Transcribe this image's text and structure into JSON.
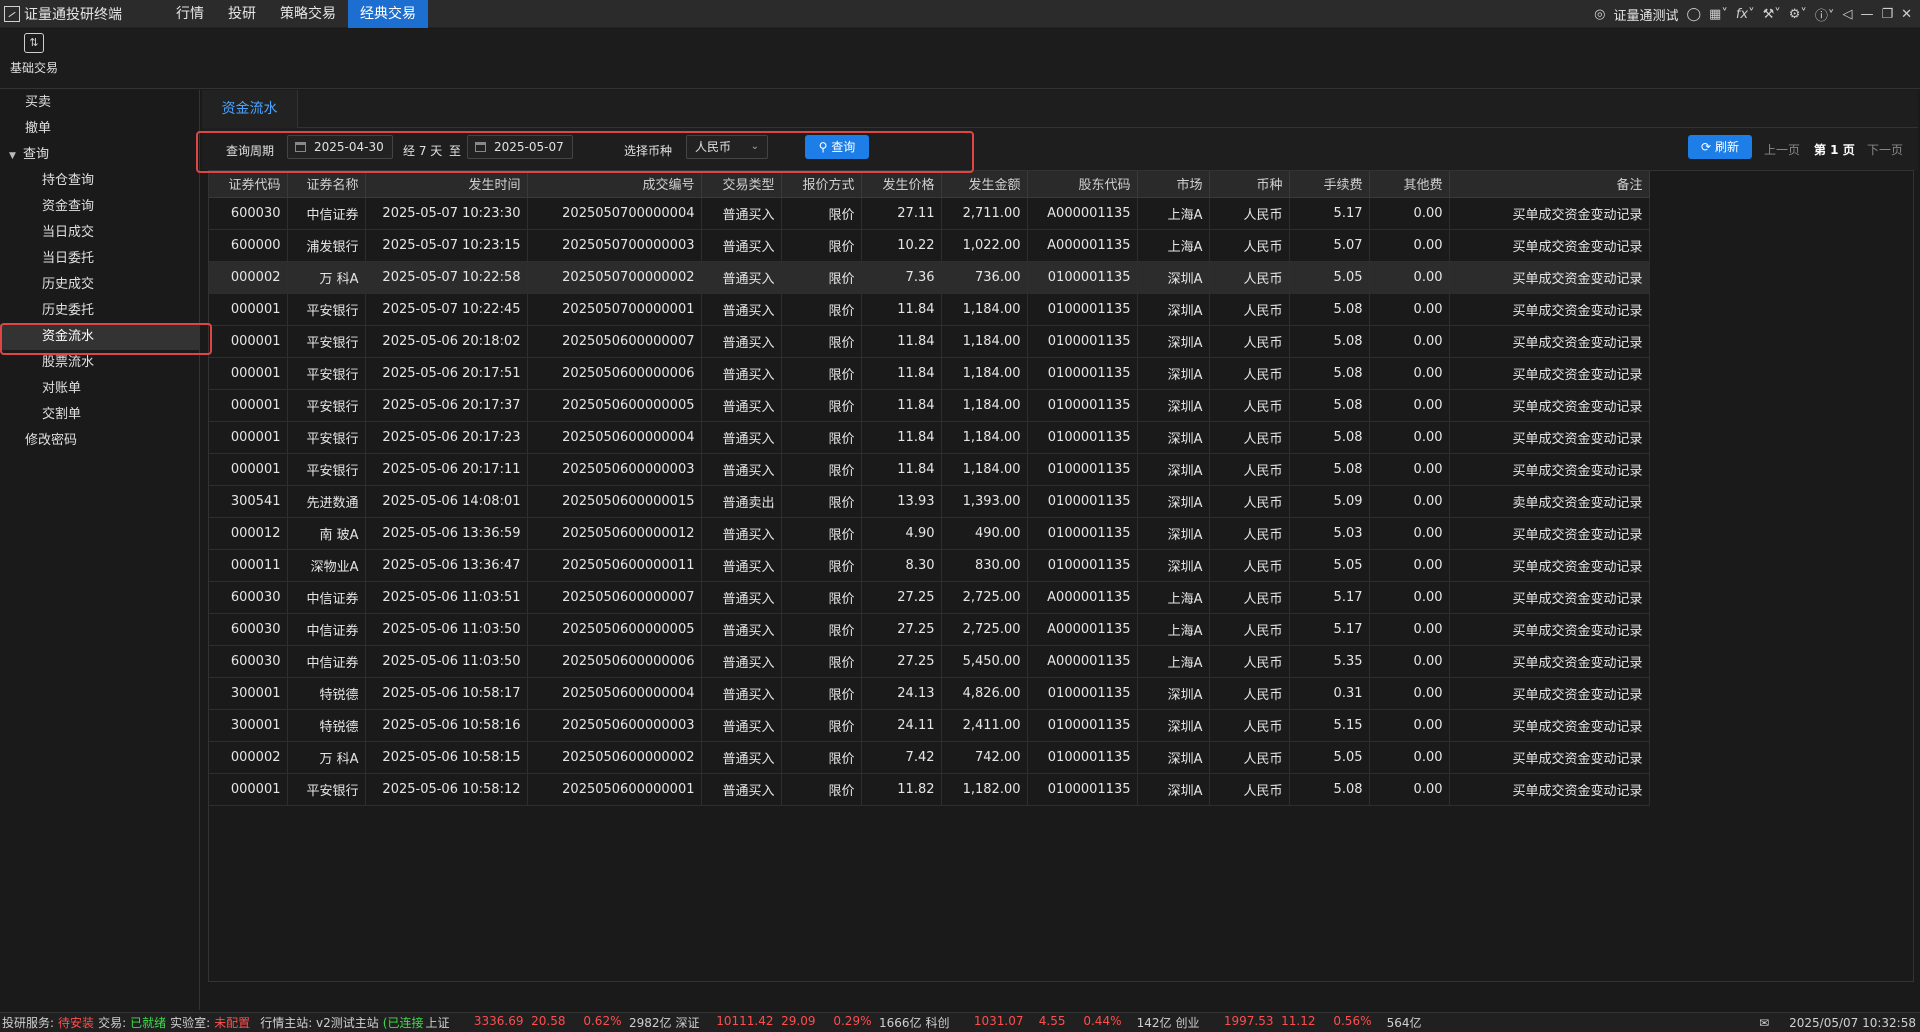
{
  "app": {
    "title": "证量通投研终端",
    "menus": [
      "行情",
      "投研",
      "策略交易",
      "经典交易"
    ],
    "active_menu_index": 3,
    "user": "证量通测试",
    "accent_color": "#1e7ee8"
  },
  "toolbar": {
    "basic_trade_label": "基础交易"
  },
  "sidebar": {
    "items": [
      {
        "label": "买卖",
        "level": 1
      },
      {
        "label": "撤单",
        "level": 1
      },
      {
        "label": "查询",
        "level": 1,
        "expanded": true
      },
      {
        "label": "持仓查询",
        "level": 2
      },
      {
        "label": "资金查询",
        "level": 2
      },
      {
        "label": "当日成交",
        "level": 2
      },
      {
        "label": "当日委托",
        "level": 2
      },
      {
        "label": "历史成交",
        "level": 2
      },
      {
        "label": "历史委托",
        "level": 2
      },
      {
        "label": "资金流水",
        "level": 2,
        "selected": true
      },
      {
        "label": "股票流水",
        "level": 2
      },
      {
        "label": "对账单",
        "level": 2
      },
      {
        "label": "交割单",
        "level": 2
      },
      {
        "label": "修改密码",
        "level": 1
      }
    ]
  },
  "tab": {
    "label": "资金流水"
  },
  "query": {
    "period_label": "查询周期",
    "start_date": "2025-04-30",
    "span_label": "经 7 天",
    "to_label": "至",
    "end_date": "2025-05-07",
    "currency_label": "选择币种",
    "currency_value": "人民币",
    "query_button": "查询",
    "refresh_button": "刷新",
    "prev_page": "上一页",
    "current_page": "第 1 页",
    "next_page": "下一页"
  },
  "table": {
    "columns": [
      "证券代码",
      "证券名称",
      "发生时间",
      "成交编号",
      "交易类型",
      "报价方式",
      "发生价格",
      "发生金额",
      "股东代码",
      "市场",
      "币种",
      "手续费",
      "其他费",
      "备注"
    ],
    "highlighted_row": 2,
    "rows": [
      [
        "600030",
        "中信证券",
        "2025-05-07 10:23:30",
        "2025050700000004",
        "普通买入",
        "限价",
        "27.11",
        "2,711.00",
        "A000001135",
        "上海A",
        "人民币",
        "5.17",
        "0.00",
        "买单成交资金变动记录"
      ],
      [
        "600000",
        "浦发银行",
        "2025-05-07 10:23:15",
        "2025050700000003",
        "普通买入",
        "限价",
        "10.22",
        "1,022.00",
        "A000001135",
        "上海A",
        "人民币",
        "5.07",
        "0.00",
        "买单成交资金变动记录"
      ],
      [
        "000002",
        "万 科A",
        "2025-05-07 10:22:58",
        "2025050700000002",
        "普通买入",
        "限价",
        "7.36",
        "736.00",
        "0100001135",
        "深圳A",
        "人民币",
        "5.05",
        "0.00",
        "买单成交资金变动记录"
      ],
      [
        "000001",
        "平安银行",
        "2025-05-07 10:22:45",
        "2025050700000001",
        "普通买入",
        "限价",
        "11.84",
        "1,184.00",
        "0100001135",
        "深圳A",
        "人民币",
        "5.08",
        "0.00",
        "买单成交资金变动记录"
      ],
      [
        "000001",
        "平安银行",
        "2025-05-06 20:18:02",
        "2025050600000007",
        "普通买入",
        "限价",
        "11.84",
        "1,184.00",
        "0100001135",
        "深圳A",
        "人民币",
        "5.08",
        "0.00",
        "买单成交资金变动记录"
      ],
      [
        "000001",
        "平安银行",
        "2025-05-06 20:17:51",
        "2025050600000006",
        "普通买入",
        "限价",
        "11.84",
        "1,184.00",
        "0100001135",
        "深圳A",
        "人民币",
        "5.08",
        "0.00",
        "买单成交资金变动记录"
      ],
      [
        "000001",
        "平安银行",
        "2025-05-06 20:17:37",
        "2025050600000005",
        "普通买入",
        "限价",
        "11.84",
        "1,184.00",
        "0100001135",
        "深圳A",
        "人民币",
        "5.08",
        "0.00",
        "买单成交资金变动记录"
      ],
      [
        "000001",
        "平安银行",
        "2025-05-06 20:17:23",
        "2025050600000004",
        "普通买入",
        "限价",
        "11.84",
        "1,184.00",
        "0100001135",
        "深圳A",
        "人民币",
        "5.08",
        "0.00",
        "买单成交资金变动记录"
      ],
      [
        "000001",
        "平安银行",
        "2025-05-06 20:17:11",
        "2025050600000003",
        "普通买入",
        "限价",
        "11.84",
        "1,184.00",
        "0100001135",
        "深圳A",
        "人民币",
        "5.08",
        "0.00",
        "买单成交资金变动记录"
      ],
      [
        "300541",
        "先进数通",
        "2025-05-06 14:08:01",
        "2025050600000015",
        "普通卖出",
        "限价",
        "13.93",
        "1,393.00",
        "0100001135",
        "深圳A",
        "人民币",
        "5.09",
        "0.00",
        "卖单成交资金变动记录"
      ],
      [
        "000012",
        "南 玻A",
        "2025-05-06 13:36:59",
        "2025050600000012",
        "普通买入",
        "限价",
        "4.90",
        "490.00",
        "0100001135",
        "深圳A",
        "人民币",
        "5.03",
        "0.00",
        "买单成交资金变动记录"
      ],
      [
        "000011",
        "深物业A",
        "2025-05-06 13:36:47",
        "2025050600000011",
        "普通买入",
        "限价",
        "8.30",
        "830.00",
        "0100001135",
        "深圳A",
        "人民币",
        "5.05",
        "0.00",
        "买单成交资金变动记录"
      ],
      [
        "600030",
        "中信证券",
        "2025-05-06 11:03:51",
        "2025050600000007",
        "普通买入",
        "限价",
        "27.25",
        "2,725.00",
        "A000001135",
        "上海A",
        "人民币",
        "5.17",
        "0.00",
        "买单成交资金变动记录"
      ],
      [
        "600030",
        "中信证券",
        "2025-05-06 11:03:50",
        "2025050600000005",
        "普通买入",
        "限价",
        "27.25",
        "2,725.00",
        "A000001135",
        "上海A",
        "人民币",
        "5.17",
        "0.00",
        "买单成交资金变动记录"
      ],
      [
        "600030",
        "中信证券",
        "2025-05-06 11:03:50",
        "2025050600000006",
        "普通买入",
        "限价",
        "27.25",
        "5,450.00",
        "A000001135",
        "上海A",
        "人民币",
        "5.35",
        "0.00",
        "买单成交资金变动记录"
      ],
      [
        "300001",
        "特锐德",
        "2025-05-06 10:58:17",
        "2025050600000004",
        "普通买入",
        "限价",
        "24.13",
        "4,826.00",
        "0100001135",
        "深圳A",
        "人民币",
        "0.31",
        "0.00",
        "买单成交资金变动记录"
      ],
      [
        "300001",
        "特锐德",
        "2025-05-06 10:58:16",
        "2025050600000003",
        "普通买入",
        "限价",
        "24.11",
        "2,411.00",
        "0100001135",
        "深圳A",
        "人民币",
        "5.15",
        "0.00",
        "买单成交资金变动记录"
      ],
      [
        "000002",
        "万 科A",
        "2025-05-06 10:58:15",
        "2025050600000002",
        "普通买入",
        "限价",
        "7.42",
        "742.00",
        "0100001135",
        "深圳A",
        "人民币",
        "5.05",
        "0.00",
        "买单成交资金变动记录"
      ],
      [
        "000001",
        "平安银行",
        "2025-05-06 10:58:12",
        "2025050600000001",
        "普通买入",
        "限价",
        "11.82",
        "1,182.00",
        "0100001135",
        "深圳A",
        "人民币",
        "5.08",
        "0.00",
        "买单成交资金变动记录"
      ]
    ]
  },
  "status": {
    "research_label": "投研服务:",
    "research_value": "待安装",
    "trade_label": "交易:",
    "trade_value": "已就绪",
    "lab_label": "实验室:",
    "lab_value": "未配置",
    "quote_label": "行情主站: v2测试主站",
    "quote_value": "(已连接",
    "markets": [
      {
        "name": "上证",
        "price": "3336.69",
        "change": "20.58",
        "pct": "0.62%",
        "volume": "2982亿"
      },
      {
        "name": "深证",
        "price": "10111.42",
        "change": "29.09",
        "pct": "0.29%",
        "volume": "1666亿"
      },
      {
        "name": "科创",
        "price": "1031.07",
        "change": "4.55",
        "pct": "0.44%",
        "volume": "142亿"
      },
      {
        "name": "创业",
        "price": "1997.53",
        "change": "11.12",
        "pct": "0.56%",
        "volume": "564亿"
      }
    ],
    "datetime": "2025/05/07 10:32:58"
  }
}
